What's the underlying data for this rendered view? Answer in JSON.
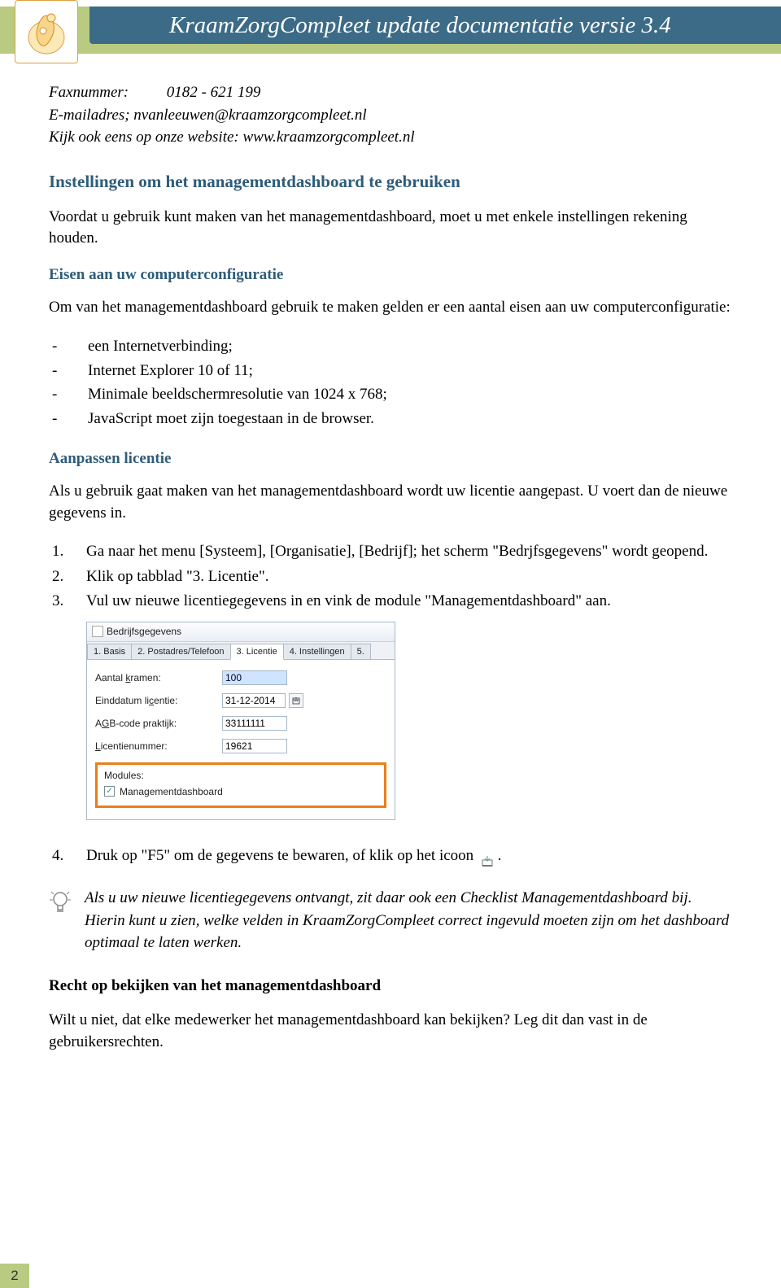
{
  "header": {
    "title": "KraamZorgCompleet update documentatie versie 3.4"
  },
  "contact": {
    "fax_label": "Faxnummer:",
    "fax_value": "0182 - 621 199",
    "email_line": "E-mailadres; nvanleeuwen@kraamzorgcompleet.nl",
    "website_line": "Kijk ook eens op onze website: www.kraamzorgcompleet.nl"
  },
  "section1": {
    "title": "Instellingen om het managementdashboard te gebruiken",
    "intro": "Voordat u gebruik kunt maken van het managementdashboard, moet u met enkele instellingen rekening houden."
  },
  "section2": {
    "title": "Eisen aan uw computerconfiguratie",
    "intro": "Om van het managementdashboard gebruik te maken gelden er een aantal eisen aan uw computerconfiguratie:",
    "bullets": [
      "een Internetverbinding;",
      "Internet Explorer 10 of 11;",
      "Minimale beeldschermresolutie van 1024 x 768;",
      "JavaScript moet zijn toegestaan in de browser."
    ]
  },
  "section3": {
    "title": "Aanpassen licentie",
    "intro": "Als u gebruik gaat maken van het managementdashboard wordt uw licentie aangepast. U voert dan de nieuwe gegevens in.",
    "steps": [
      "Ga naar het menu [Systeem], [Organisatie], [Bedrijf]; het scherm \"Bedrjfsgegevens\" wordt geopend.",
      "Klik op tabblad \"3. Licentie\".",
      "Vul uw nieuwe licentiegegevens in en vink de module \"Managementdashboard\" aan."
    ]
  },
  "win": {
    "title": "Bedrijfsgegevens",
    "tabs": [
      "1. Basis",
      "2. Postadres/Telefoon",
      "3. Licentie",
      "4. Instellingen",
      "5."
    ],
    "active_tab_index": 2,
    "fields": {
      "aantal_label": "Aantal kramen:",
      "aantal_value": "100",
      "einddatum_label": "Einddatum licentie:",
      "einddatum_value": "31-12-2014",
      "agb_label": "AGB-code praktijk:",
      "agb_value": "33111111",
      "licentie_label": "Licentienummer:",
      "licentie_value": "19621"
    },
    "modules_label": "Modules:",
    "module_checkbox_label": "Managementdashboard",
    "module_checked": "✓"
  },
  "step4_text": "Druk op \"F5\" om de gegevens te bewaren, of klik op het icoon ",
  "step4_tail": ".",
  "tip": "Als u uw nieuwe licentiegegevens ontvangt, zit daar ook een Checklist Managementdashboard bij. Hierin kunt u zien, welke velden in KraamZorgCompleet correct ingevuld moeten zijn om het dashboard optimaal te laten werken.",
  "section4": {
    "title": "Recht op bekijken van het managementdashboard",
    "body": "Wilt u niet, dat elke medewerker het managementdashboard kan bekijken? Leg dit dan vast in de gebruikersrechten."
  },
  "page_number": "2"
}
